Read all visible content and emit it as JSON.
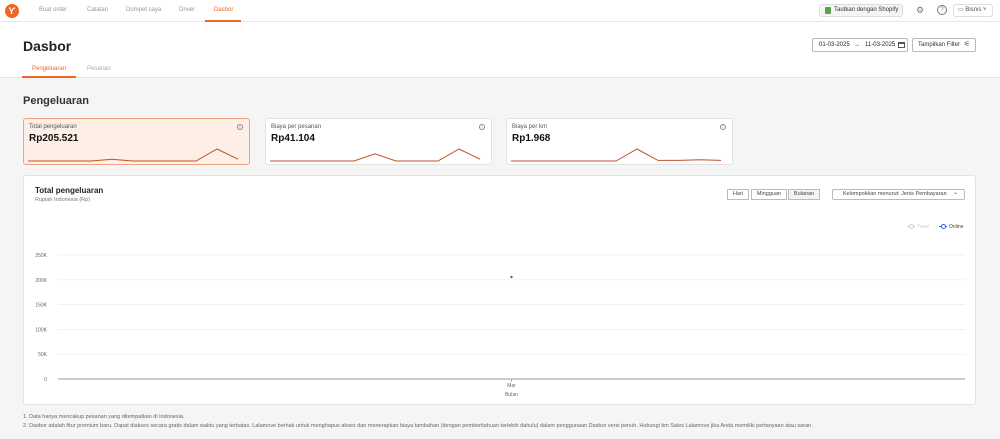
{
  "nav": {
    "items": [
      "Buat order",
      "Catatan",
      "Dompet saya",
      "Driver",
      "Dasbor"
    ],
    "active_index": 4,
    "shopify_label": "Tautkan dengan Shopify",
    "business_label": "Bisnis"
  },
  "header": {
    "title": "Dasbor",
    "date_start": "01-03-2025",
    "date_end": "11-03-2025",
    "filter_label": "Tampilkan Filter",
    "tabs": [
      "Pengeluaran",
      "Pesanan"
    ]
  },
  "section_title": "Pengeluaran",
  "cards": [
    {
      "label": "Total pengeluaran",
      "value": "Rp205.521",
      "spark": [
        0,
        0,
        0,
        0,
        0.15,
        0,
        0,
        0,
        0,
        1,
        0.15
      ]
    },
    {
      "label": "Biaya per pesanan",
      "value": "Rp41.104",
      "spark": [
        0,
        0,
        0,
        0,
        0,
        0.6,
        0,
        0,
        0,
        1,
        0.15
      ]
    },
    {
      "label": "Biaya per km",
      "value": "Rp1.968",
      "spark": [
        0,
        0,
        0,
        0,
        0,
        0,
        1,
        0.05,
        0.05,
        0.1,
        0.05
      ]
    }
  ],
  "panel": {
    "title": "Total pengeluaran",
    "subtitle": "Rupiah Indonesia (Rp)",
    "periods": [
      "Hari",
      "Mingguan",
      "Bulanan"
    ],
    "selected_period": "Bulanan",
    "group_label": "Kelompokkan menurut: Jenis Pembayaran"
  },
  "chart_data": {
    "type": "scatter",
    "xlabel": "Bulan",
    "ylabel": "",
    "categories": [
      "Mar"
    ],
    "ylim": [
      0,
      250000
    ],
    "y_ticks": [
      0,
      50000,
      100000,
      150000,
      200000,
      250000
    ],
    "y_tick_labels": [
      "0",
      "50K",
      "100K",
      "150K",
      "200K",
      "250K"
    ],
    "series": [
      {
        "name": "Tunai",
        "values": [
          null
        ],
        "color": "#c8cdd8"
      },
      {
        "name": "Online",
        "values": [
          205521
        ],
        "color": "#3b5bdb"
      }
    ],
    "legend_position": "top-right",
    "grid": true
  },
  "footnotes": [
    "1. Data hanya mencakup pesanan yang ditempatkan di Indonesia.",
    "2. Dasbor adalah fitur premium baru. Dapat diakses secara gratis dalam waktu yang terbatas. Lalamove berhak untuk menghapus akses dan menerapkan biaya tambahan (dengan pemberitahuan terlebih dahulu) dalam penggunaan Dasbor versi penuh. Hubungi tim Sales Lalamove jika Anda memiliki pertanyaan atau saran."
  ],
  "colors": {
    "accent": "#f16622",
    "spark": "#c2502a"
  }
}
